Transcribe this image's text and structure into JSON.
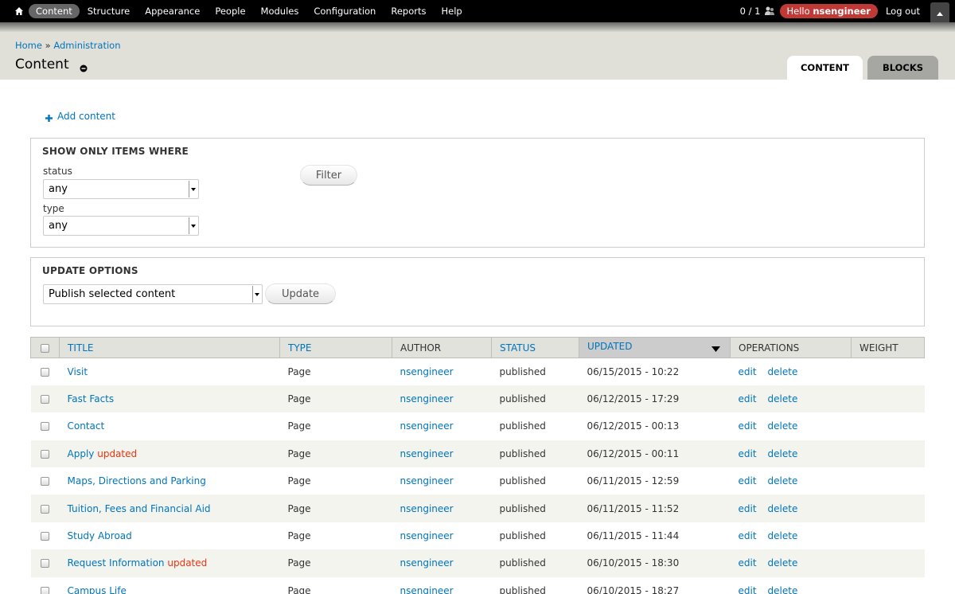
{
  "toolbar": {
    "menu": [
      {
        "label": "Content",
        "active": true
      },
      {
        "label": "Structure"
      },
      {
        "label": "Appearance"
      },
      {
        "label": "People"
      },
      {
        "label": "Modules"
      },
      {
        "label": "Configuration"
      },
      {
        "label": "Reports"
      },
      {
        "label": "Help"
      }
    ],
    "user_count": "0 / 1",
    "hello_prefix": "Hello ",
    "username": "nsengineer",
    "logout": "Log out"
  },
  "header": {
    "breadcrumb": [
      {
        "label": "Home"
      },
      {
        "label": "Administration"
      }
    ],
    "breadcrumb_sep": " » ",
    "title": "Content",
    "tabs": [
      {
        "label": "Content",
        "active": true
      },
      {
        "label": "Blocks",
        "active": false
      }
    ]
  },
  "actions": {
    "add_content": "Add content"
  },
  "filter": {
    "legend": "Show only items where",
    "status_label": "status",
    "status_value": "any",
    "type_label": "type",
    "type_value": "any",
    "filter_button": "Filter"
  },
  "update": {
    "legend": "Update options",
    "operation_value": "Publish selected content",
    "update_button": "Update"
  },
  "table": {
    "headers": {
      "title": "Title",
      "type": "Type",
      "author": "Author",
      "status": "Status",
      "updated": "Updated",
      "operations": "Operations",
      "weight": "Weight"
    },
    "rows": [
      {
        "title": "Visit",
        "marker": "",
        "type": "Page",
        "author": "nsengineer",
        "status": "published",
        "updated": "06/15/2015 - 10:22",
        "edit": "edit",
        "delete": "delete"
      },
      {
        "title": "Fast Facts",
        "marker": "",
        "type": "Page",
        "author": "nsengineer",
        "status": "published",
        "updated": "06/12/2015 - 17:29",
        "edit": "edit",
        "delete": "delete"
      },
      {
        "title": "Contact",
        "marker": "",
        "type": "Page",
        "author": "nsengineer",
        "status": "published",
        "updated": "06/12/2015 - 00:13",
        "edit": "edit",
        "delete": "delete"
      },
      {
        "title": "Apply",
        "marker": "updated",
        "type": "Page",
        "author": "nsengineer",
        "status": "published",
        "updated": "06/12/2015 - 00:11",
        "edit": "edit",
        "delete": "delete"
      },
      {
        "title": "Maps, Directions and Parking",
        "marker": "",
        "type": "Page",
        "author": "nsengineer",
        "status": "published",
        "updated": "06/11/2015 - 12:59",
        "edit": "edit",
        "delete": "delete"
      },
      {
        "title": "Tuition, Fees and Financial Aid",
        "marker": "",
        "type": "Page",
        "author": "nsengineer",
        "status": "published",
        "updated": "06/11/2015 - 11:52",
        "edit": "edit",
        "delete": "delete"
      },
      {
        "title": "Study Abroad",
        "marker": "",
        "type": "Page",
        "author": "nsengineer",
        "status": "published",
        "updated": "06/11/2015 - 11:44",
        "edit": "edit",
        "delete": "delete"
      },
      {
        "title": "Request Information",
        "marker": "updated",
        "type": "Page",
        "author": "nsengineer",
        "status": "published",
        "updated": "06/10/2015 - 18:30",
        "edit": "edit",
        "delete": "delete"
      },
      {
        "title": "Campus Life",
        "marker": "",
        "type": "Page",
        "author": "nsengineer",
        "status": "published",
        "updated": "06/10/2015 - 18:27",
        "edit": "edit",
        "delete": "delete"
      }
    ]
  },
  "icons": {
    "home": "home-icon",
    "users": "users-icon",
    "drawer": "chevron-up-icon",
    "shortcut": "shortcut-toggle-icon",
    "add": "plus-icon",
    "sort": "sort-desc-icon",
    "select_arrow": "select-arrow-icon"
  },
  "colors": {
    "toolbar_bg": "#000000",
    "hello_bg": "#bf3936",
    "link": "#0074bd",
    "marker": "#ee3311",
    "header_bg": "#e0e0d8"
  }
}
